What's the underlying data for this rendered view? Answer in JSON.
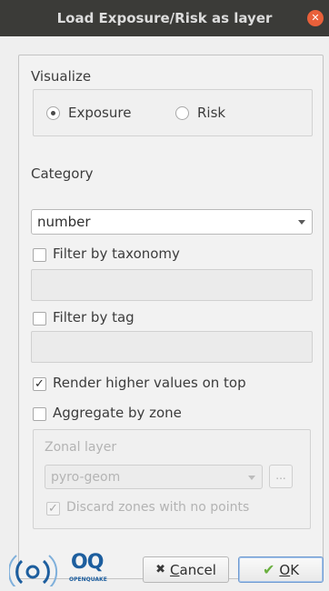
{
  "window": {
    "title": "Load Exposure/Risk as layer",
    "close_icon": "close-icon",
    "accent": "#e9603a"
  },
  "visualize": {
    "label": "Visualize",
    "options": [
      {
        "label": "Exposure",
        "selected": true
      },
      {
        "label": "Risk",
        "selected": false
      }
    ]
  },
  "category": {
    "label": "Category",
    "value": "number"
  },
  "filter_taxonomy": {
    "label": "Filter by taxonomy",
    "checked": false,
    "value": ""
  },
  "filter_tag": {
    "label": "Filter by tag",
    "checked": false,
    "value": ""
  },
  "render_higher": {
    "label": "Render higher values on top",
    "checked": true
  },
  "aggregate_zone": {
    "label": "Aggregate by zone",
    "checked": false
  },
  "zonal": {
    "label": "Zonal layer",
    "value": "pyro-geom",
    "browse_label": "...",
    "discard_label": "Discard zones with no points",
    "discard_checked": true
  },
  "footer": {
    "logo_text": "OQ",
    "logo_subtext": "OPENQUAKE",
    "cancel_label": "Cancel",
    "cancel_mnemonic": "C",
    "cancel_rest": "ancel",
    "ok_mnemonic": "O",
    "ok_rest": "K",
    "check_color": "#6bb040",
    "cancel_icon": "x-icon",
    "ok_icon": "checkmark-icon"
  }
}
